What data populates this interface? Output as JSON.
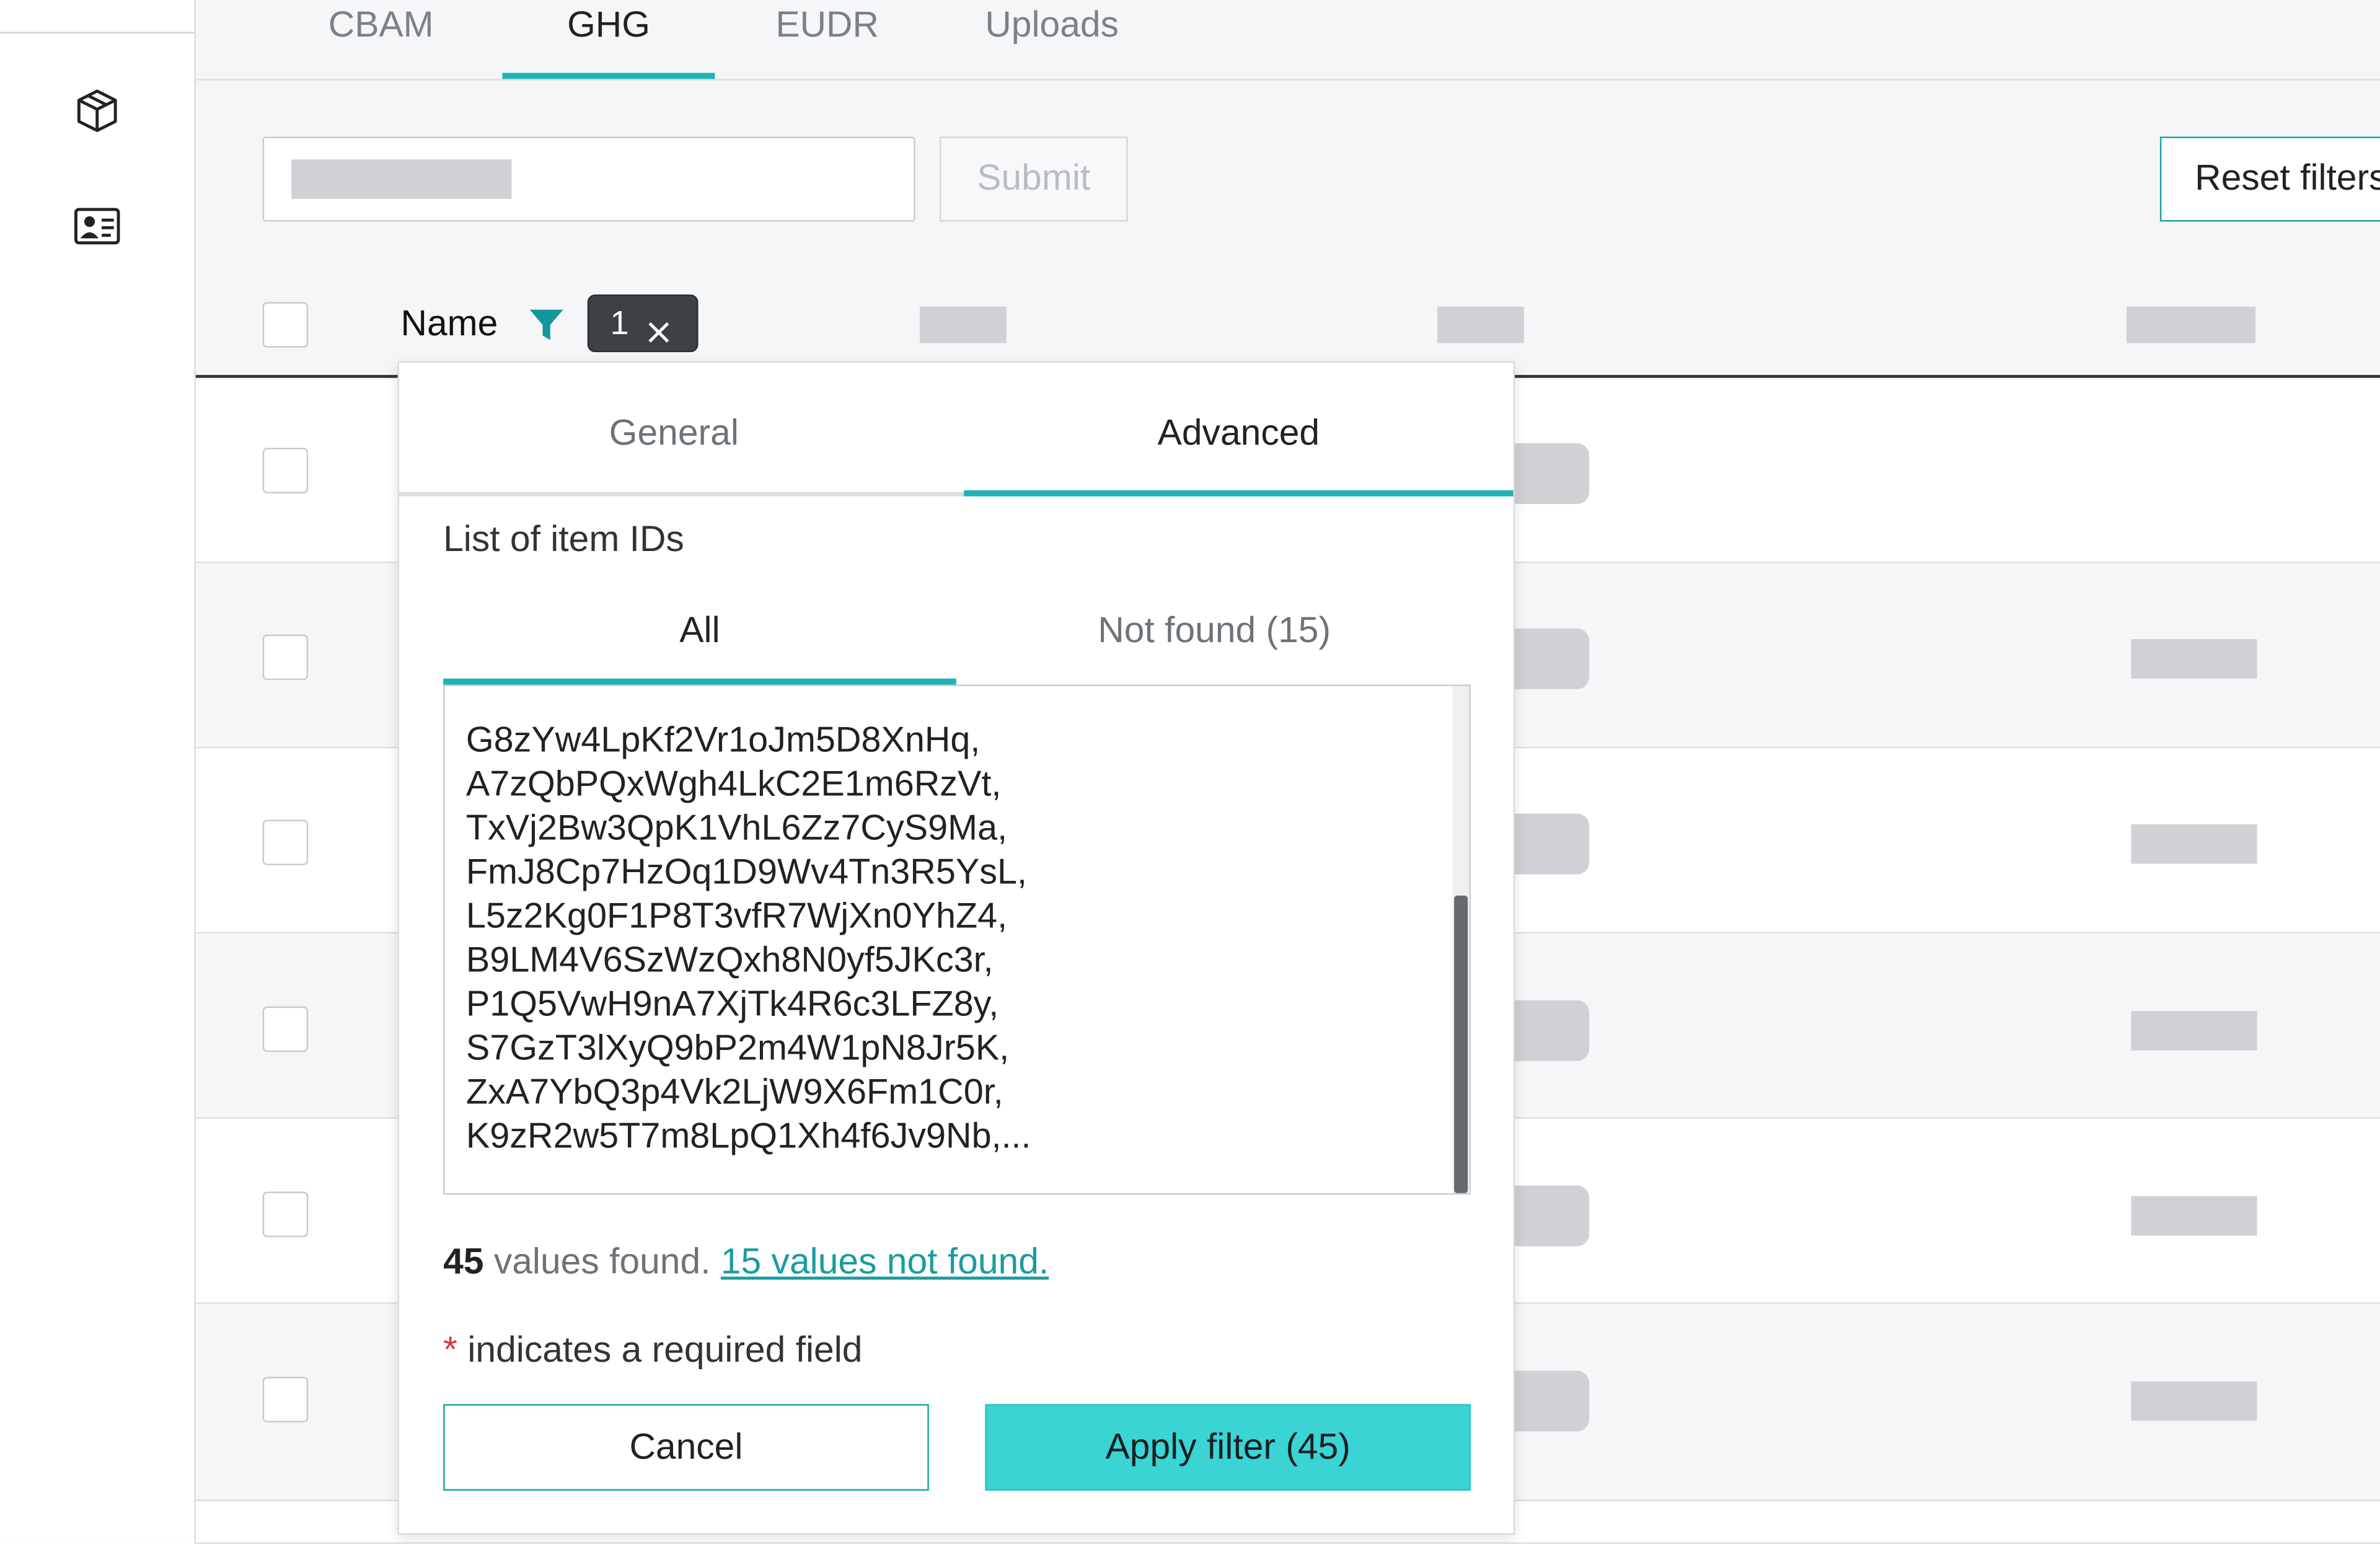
{
  "tabs": [
    {
      "label": "CBAM",
      "active": false
    },
    {
      "label": "GHG",
      "active": true
    },
    {
      "label": "EUDR",
      "active": false
    },
    {
      "label": "Uploads",
      "active": false
    }
  ],
  "rail": {
    "icons": [
      "package-icon",
      "id-card-icon"
    ]
  },
  "toolbar": {
    "search_value": "",
    "submit_label": "Submit",
    "reset_label": "Reset filters"
  },
  "table": {
    "name_header": "Name",
    "filter_chip_count": "1",
    "row_count": 6
  },
  "filter_popup": {
    "tabs": [
      {
        "label": "General",
        "active": false
      },
      {
        "label": "Advanced",
        "active": true
      }
    ],
    "list_title": "List of item IDs",
    "subtabs": [
      {
        "label": "All",
        "active": true
      },
      {
        "label": "Not found (15)",
        "active": false
      }
    ],
    "ids": [
      "G8zYw4LpKf2Vr1oJm5D8XnHq,",
      "A7zQbPQxWgh4LkC2E1m6RzVt,",
      "TxVj2Bw3QpK1VhL6Zz7CyS9Ma,",
      "FmJ8Cp7HzOq1D9Wv4Tn3R5YsL,",
      "L5z2Kg0F1P8T3vfR7WjXn0YhZ4,",
      "B9LM4V6SzWzQxh8N0yf5JKc3r,",
      "P1Q5VwH9nA7XjTk4R6c3LFZ8y,",
      "S7GzT3lXyQ9bP2m4W1pN8Jr5K,",
      "ZxA7YbQ3p4Vk2LjW9X6Fm1C0r,",
      "K9zR2w5T7m8LpQ1Xh4f6Jv9Nb,..."
    ],
    "found_count": "45",
    "found_text": "values found.",
    "not_found_link": "15 values not found.",
    "required_star": "*",
    "required_text": "indicates a required field",
    "cancel_label": "Cancel",
    "apply_label": "Apply filter (45)"
  },
  "colors": {
    "accent": "#1fb3b5",
    "apply_bg": "#3ad4d4",
    "chip_bg": "#3d4145"
  }
}
